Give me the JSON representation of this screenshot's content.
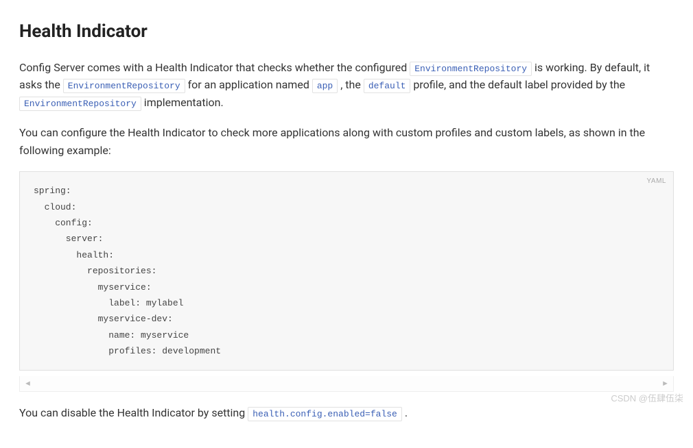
{
  "heading": "Health Indicator",
  "para1": {
    "t1": "Config Server comes with a Health Indicator that checks whether the configured ",
    "c1": "EnvironmentRepository",
    "t2": " is working. By default, it asks the ",
    "c2": "EnvironmentRepository",
    "t3": " for an application named ",
    "c3": "app",
    "t4": ", the ",
    "c4": "default",
    "t5": " profile, and the default label provided by the ",
    "c5": "EnvironmentRepository",
    "t6": " implementation."
  },
  "para2": "You can configure the Health Indicator to check more applications along with custom profiles and custom labels, as shown in the following example:",
  "code": {
    "lang": "YAML",
    "content": "spring:\n  cloud:\n    config:\n      server:\n        health:\n          repositories:\n            myservice:\n              label: mylabel\n            myservice-dev:\n              name: myservice\n              profiles: development"
  },
  "scroll": {
    "left": "◄",
    "right": "►"
  },
  "para3": {
    "t1": "You can disable the Health Indicator by setting ",
    "c1": "health.config.enabled=false",
    "t2": " ."
  },
  "watermark": "CSDN @伍肆伍柒"
}
